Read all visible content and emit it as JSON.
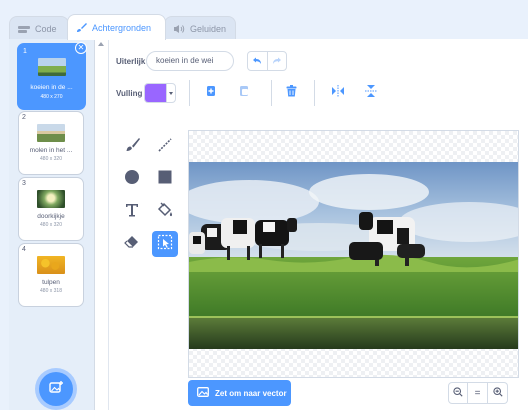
{
  "tabs": [
    {
      "label": "Code",
      "icon": "code-icon"
    },
    {
      "label": "Achtergronden",
      "icon": "brush-icon"
    },
    {
      "label": "Geluiden",
      "icon": "speaker-icon"
    }
  ],
  "costumes": [
    {
      "num": "1",
      "name": "koeien in de ...",
      "size": "480 x 270",
      "selected": true
    },
    {
      "num": "2",
      "name": "molen in het ...",
      "size": "480 x 320",
      "selected": false
    },
    {
      "num": "3",
      "name": "doorkijkje",
      "size": "480 x 320",
      "selected": false
    },
    {
      "num": "4",
      "name": "tulpen",
      "size": "480 x 318",
      "selected": false
    }
  ],
  "editor": {
    "costume_label": "Uiterlijk",
    "costume_name": "koeien in de wei",
    "fill_label": "Vulling",
    "fill_color": "#9966ff",
    "convert_button": "Zet om naar vector",
    "zoom_reset": "="
  },
  "colors": {
    "accent": "#4c97ff"
  }
}
